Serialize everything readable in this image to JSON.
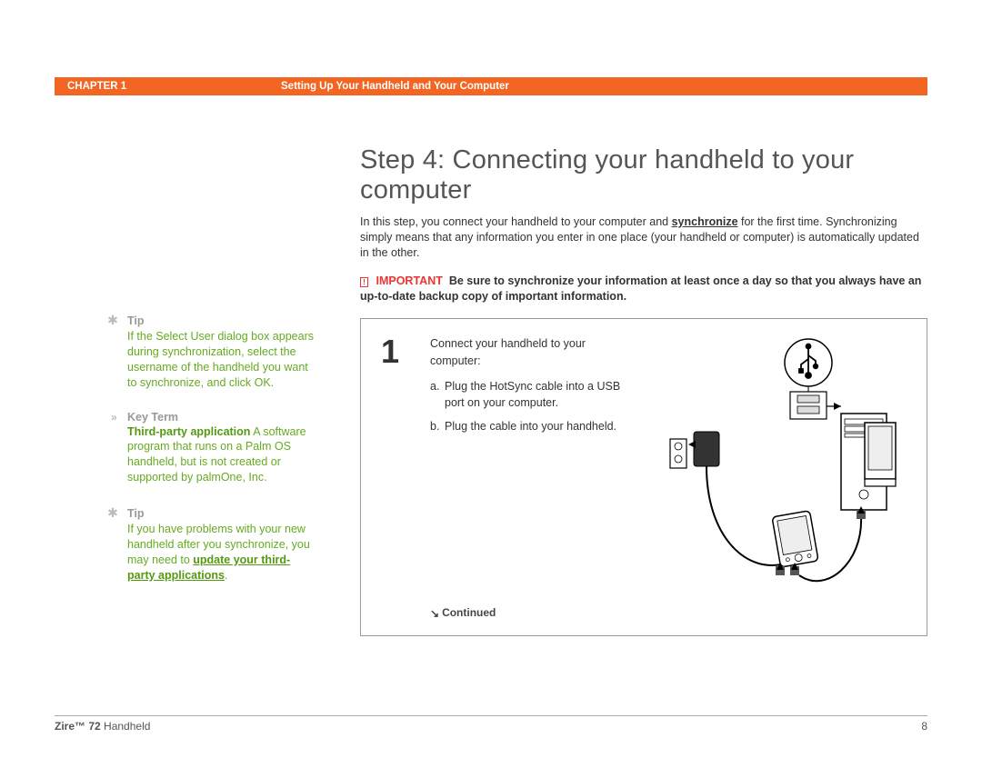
{
  "header": {
    "chapter_label": "CHAPTER 1",
    "section_title": "Setting Up Your Handheld and Your Computer"
  },
  "main": {
    "heading": "Step 4: Connecting your handheld to your computer",
    "intro_pre": "In this step, you connect your handheld to your computer and ",
    "intro_link": "synchronize",
    "intro_post": " for the first time. Synchronizing simply means that any information you enter in one place (your handheld or computer) is automatically updated in the other.",
    "important_label": "IMPORTANT",
    "important_text": "Be sure to synchronize your information at least once a day so that you always have an up-to-date backup copy of important information.",
    "step_number": "1",
    "step_intro": "Connect your handheld to your computer:",
    "step_a_label": "a.",
    "step_a": "Plug the HotSync cable into a USB port on your computer.",
    "step_b_label": "b.",
    "step_b": "Plug the cable into your handheld.",
    "continued": "Continued"
  },
  "sidebar": {
    "items": [
      {
        "icon": "asterisk",
        "label": "Tip",
        "body": "If the Select User dialog box appears during synchronization, select the username of the handheld you want to synchronize, and click OK."
      },
      {
        "icon": "chevrons",
        "label": "Key Term",
        "term": "Third-party application",
        "body": " A software program that runs on a Palm OS handheld, but is not created or supported by palmOne, Inc."
      },
      {
        "icon": "asterisk",
        "label": "Tip",
        "body_pre": "If you have problems with your new handheld after you synchronize, you may need to ",
        "link": "update your third-party applications",
        "body_post": "."
      }
    ]
  },
  "footer": {
    "product_bold": "Zire™ 72",
    "product_rest": " Handheld",
    "page": "8"
  }
}
